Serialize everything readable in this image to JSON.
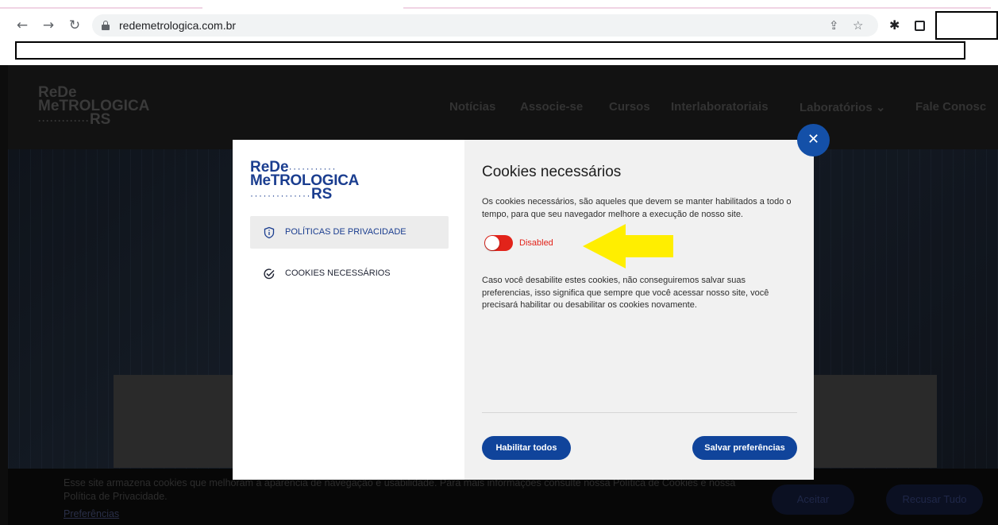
{
  "browser": {
    "url": "redemetrologica.com.br",
    "icons": {
      "back": "back-arrow-icon",
      "forward": "forward-arrow-icon",
      "reload": "reload-icon",
      "lock": "lock-icon",
      "share": "share-icon",
      "bookmark": "star-icon",
      "extensions": "puzzle-icon",
      "sidepanel": "square-icon"
    }
  },
  "site": {
    "logo_line1": "ReDe",
    "logo_line2": "MeTROLOGICA",
    "logo_line3": "RS",
    "nav": [
      "Notícias",
      "Associe-se",
      "Cursos",
      "Interlaboratoriais",
      "Laboratórios ⌄",
      "Fale Conosc"
    ]
  },
  "cookie_bar": {
    "text": "Esse site armazena cookies que melhoram a aparência de navegação e usabilidade. Para mais informações consulte nossa Política de Cookies e nossa Política de Privacidade.",
    "preferences_link": "Preferências",
    "accept": "Aceitar",
    "reject": "Recusar Tudo"
  },
  "modal": {
    "logo": {
      "line1": "ReDe",
      "line1_dots": "···········",
      "line2": "MeTROLOGICA",
      "line3_dots": "··············",
      "line3": "RS"
    },
    "sidebar": [
      {
        "label": "POLÍTICAS DE PRIVACIDADE",
        "icon": "shield-info-icon",
        "active": true
      },
      {
        "label": "COOKIES NECESSÁRIOS",
        "icon": "check-circle-icon",
        "active": false
      }
    ],
    "main": {
      "title": "Cookies necessários",
      "paragraph1": "Os cookies necessários, são aqueles que devem se manter habilitados a todo o tempo, para que seu navegador melhore a execução de nosso site.",
      "toggle_label": "Disabled",
      "paragraph2": "Caso você desabilite estes cookies, não conseguiremos salvar suas preferencias, isso significa que sempre que você acessar nosso site, você precisará habilitar ou desabilitar os cookies novamente.",
      "enable_all": "Habilitar todos",
      "save_prefs": "Salvar preferências"
    },
    "close_icon": "close-icon"
  },
  "colors": {
    "brand_blue": "#10449b",
    "toggle_red": "#e2231a",
    "arrow_yellow": "#ffee00"
  }
}
